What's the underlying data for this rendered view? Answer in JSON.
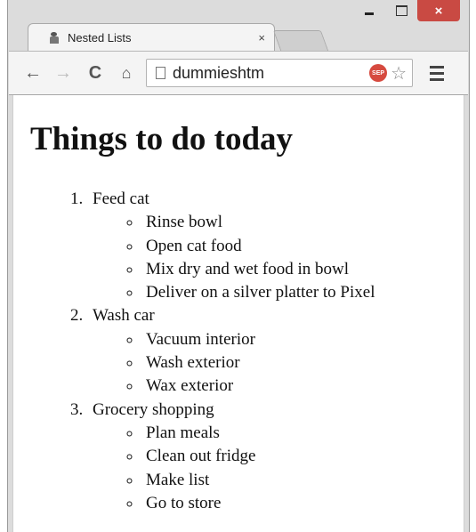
{
  "window": {
    "controls": {
      "minimize": "–",
      "maximize": "□",
      "close": "×"
    }
  },
  "tab": {
    "title": "Nested Lists",
    "close": "×",
    "favicon": "page-favicon-icon"
  },
  "toolbar": {
    "back": "←",
    "forward": "→",
    "reload": "C",
    "home": "⌂",
    "url": "dummieshtm",
    "extension_badge": "SEP",
    "bookmark": "☆"
  },
  "page": {
    "heading": "Things to do today",
    "list": [
      {
        "label": "Feed cat",
        "subitems": [
          "Rinse bowl",
          "Open cat food",
          "Mix dry and wet food in bowl",
          "Deliver on a silver platter to Pixel"
        ]
      },
      {
        "label": "Wash car",
        "subitems": [
          "Vacuum interior",
          "Wash exterior",
          "Wax exterior"
        ]
      },
      {
        "label": "Grocery shopping",
        "subitems": [
          "Plan meals",
          "Clean out fridge",
          "Make list",
          "Go to store"
        ]
      }
    ]
  },
  "colors": {
    "close_button": "#c94a43",
    "chrome": "#f4f4f4",
    "frame": "#dcdcdc"
  }
}
